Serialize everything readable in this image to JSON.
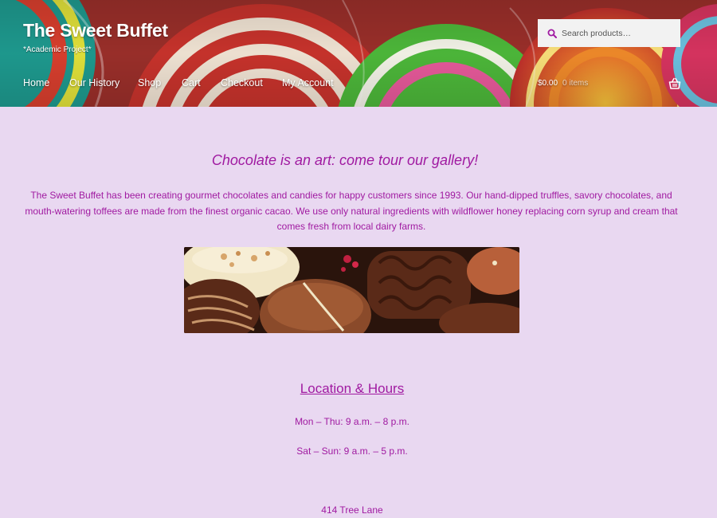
{
  "header": {
    "site_title": "The Sweet Buffet",
    "site_tagline": "*Academic Project*",
    "search": {
      "placeholder": "Search products…",
      "value": ""
    },
    "nav": [
      "Home",
      "Our History",
      "Shop",
      "Cart",
      "Checkout",
      "My Account"
    ],
    "cart": {
      "total": "$0.00",
      "items": "0 items"
    },
    "icons": {
      "search": "search-icon",
      "basket": "basket-icon"
    }
  },
  "main": {
    "heading": "Chocolate is an art: come tour our gallery!",
    "intro": "The Sweet Buffet has been creating gourmet chocolates and candies for happy customers since 1993. Our hand-dipped truffles, savory chocolates, and mouth-watering toffees are made from the finest organic cacao. We use only natural ingredients with wildflower honey replacing corn syrup and cream that comes fresh from local dairy farms.",
    "location_heading": "Location & Hours",
    "hours": [
      "Mon – Thu: 9 a.m. – 8 p.m.",
      "Sat – Sun: 9 a.m. – 5 p.m."
    ],
    "address": "414 Tree Lane"
  },
  "colors": {
    "page_background": "#e9d8f1",
    "text_accent": "#a01aa1",
    "search_icon": "#a01aa1"
  }
}
